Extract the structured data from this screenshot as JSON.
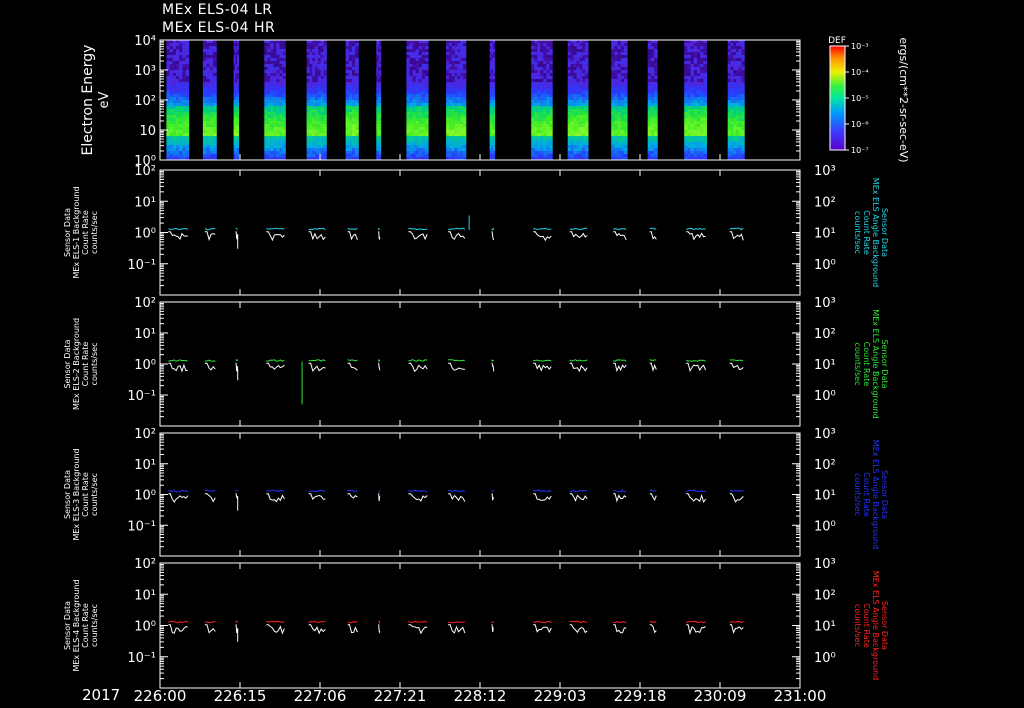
{
  "titles": [
    "MEx ELS-04 LR",
    "MEx ELS-04 HR"
  ],
  "date_label": "2017",
  "colorbar": {
    "title": "DEF",
    "unit_label": "ergs/(cm**2-sr-sec-eV)",
    "tick_labels": [
      "10⁻³",
      "10⁻⁴",
      "10⁻⁵",
      "10⁻⁶",
      "10⁻⁷"
    ]
  },
  "chart_data": [
    {
      "type": "heatmap",
      "ylabel": [
        "Electron Energy",
        "eV"
      ],
      "yscale": "log",
      "ylim": [
        1,
        10000
      ],
      "tick_labels": [
        "10⁴",
        "10³",
        "10²",
        "10",
        "10⁰"
      ],
      "x_tick_labels": [
        "226:00",
        "226:15",
        "227:06",
        "227:21",
        "228:12",
        "229:03",
        "229:18",
        "230:09",
        "231:00"
      ],
      "data_intervals_fraction": [
        [
          0.01,
          0.045
        ],
        [
          0.067,
          0.088
        ],
        [
          0.115,
          0.123
        ],
        [
          0.163,
          0.196
        ],
        [
          0.229,
          0.26
        ],
        [
          0.29,
          0.31
        ],
        [
          0.338,
          0.345
        ],
        [
          0.385,
          0.419
        ],
        [
          0.447,
          0.478
        ],
        [
          0.515,
          0.523
        ],
        [
          0.58,
          0.613
        ],
        [
          0.637,
          0.669
        ],
        [
          0.705,
          0.73
        ],
        [
          0.762,
          0.777
        ],
        [
          0.819,
          0.854
        ],
        [
          0.887,
          0.913
        ]
      ]
    },
    {
      "type": "line",
      "ylabel": [
        "Sensor Data",
        "MEx ELS-1 Background",
        "Count Rate",
        "counts/sec"
      ],
      "right_label": [
        "Sensor Data",
        "MEx ELS Angle Background",
        "Count Rate",
        "counts/sec"
      ],
      "color": "#22d3e6",
      "yscale": "log",
      "ylim": [
        0.01,
        100
      ],
      "right_ylim": [
        0.1,
        1000
      ],
      "left_tick_labels": [
        "10²",
        "10¹",
        "10⁰",
        "10⁻¹"
      ],
      "right_tick_labels": [
        "10³",
        "10²",
        "10¹",
        "10⁰"
      ],
      "series": [
        {
          "role": "background",
          "level": 1.3
        },
        {
          "role": "sensor",
          "level": 0.75
        }
      ]
    },
    {
      "type": "line",
      "ylabel": [
        "Sensor Data",
        "MEx ELS-2 Background",
        "Count Rate",
        "counts/sec"
      ],
      "right_label": [
        "Sensor Data",
        "MEx ELS Angle Background",
        "Count Rate",
        "counts/sec"
      ],
      "color": "#2ee63a",
      "yscale": "log",
      "ylim": [
        0.01,
        100
      ],
      "right_ylim": [
        0.1,
        1000
      ],
      "left_tick_labels": [
        "10²",
        "10¹",
        "10⁰",
        "10⁻¹"
      ],
      "right_tick_labels": [
        "10³",
        "10²",
        "10¹",
        "10⁰"
      ],
      "series": [
        {
          "role": "background",
          "level": 1.3
        },
        {
          "role": "sensor",
          "level": 0.75
        }
      ]
    },
    {
      "type": "line",
      "ylabel": [
        "Sensor Data",
        "MEx ELS-3 Background",
        "Count Rate",
        "counts/sec"
      ],
      "right_label": [
        "Sensor Data",
        "MEx ELS Angle Background",
        "Count Rate",
        "counts/sec"
      ],
      "color": "#2233ff",
      "yscale": "log",
      "ylim": [
        0.01,
        100
      ],
      "right_ylim": [
        0.1,
        1000
      ],
      "left_tick_labels": [
        "10²",
        "10¹",
        "10⁰",
        "10⁻¹"
      ],
      "right_tick_labels": [
        "10³",
        "10²",
        "10¹",
        "10⁰"
      ],
      "series": [
        {
          "role": "background",
          "level": 1.3
        },
        {
          "role": "sensor",
          "level": 0.75
        }
      ]
    },
    {
      "type": "line",
      "ylabel": [
        "Sensor Data",
        "MEx ELS-4 Background",
        "Count Rate",
        "counts/sec"
      ],
      "right_label": [
        "Sensor Data",
        "MEx ELS Angle Background",
        "Count Rate",
        "counts/sec"
      ],
      "color": "#ff2222",
      "yscale": "log",
      "ylim": [
        0.01,
        100
      ],
      "right_ylim": [
        0.1,
        1000
      ],
      "left_tick_labels": [
        "10²",
        "10¹",
        "10⁰",
        "10⁻¹"
      ],
      "right_tick_labels": [
        "10³",
        "10²",
        "10¹",
        "10⁰"
      ],
      "series": [
        {
          "role": "background",
          "level": 1.3
        },
        {
          "role": "sensor",
          "level": 0.75
        }
      ]
    }
  ]
}
